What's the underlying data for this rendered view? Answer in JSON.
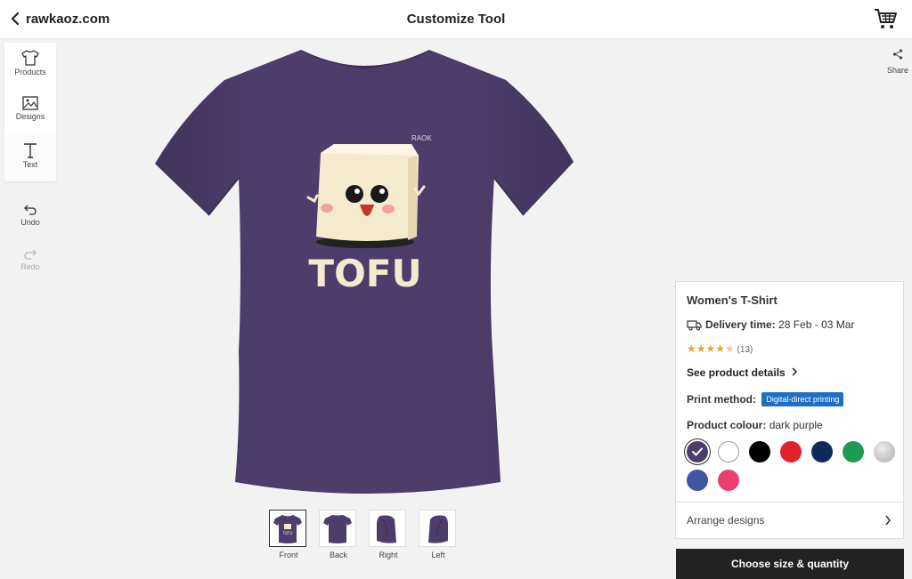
{
  "header": {
    "site_name": "rawkaoz.com",
    "title": "Customize Tool"
  },
  "toolbox": {
    "items": [
      {
        "label": "Products",
        "icon": "tshirt-icon"
      },
      {
        "label": "Designs",
        "icon": "image-icon"
      },
      {
        "label": "Text",
        "icon": "text-icon"
      }
    ],
    "undo_label": "Undo",
    "redo_label": "Redo"
  },
  "share_label": "Share",
  "canvas": {
    "shirt_colour": "#4d3d6b",
    "design_text": "TOFU",
    "design_signature": "RAOK"
  },
  "views": [
    {
      "label": "Front",
      "active": true
    },
    {
      "label": "Back",
      "active": false
    },
    {
      "label": "Right",
      "active": false
    },
    {
      "label": "Left",
      "active": false
    }
  ],
  "product": {
    "name": "Women's T-Shirt",
    "delivery_label": "Delivery time:",
    "delivery_value": "28 Feb - 03 Mar",
    "rating_stars": 4.5,
    "rating_count": "(13)",
    "details_link": "See product details",
    "print_label": "Print method:",
    "print_value": "Digital-direct printing",
    "colour_label": "Product colour:",
    "colour_value": "dark purple",
    "colours": [
      "#4d3d6b",
      "#ffffff",
      "#000000",
      "#e2232c",
      "#0f2a5a",
      "#1e9b52",
      "#c8c8c8",
      "#3f56a0",
      "#e8416f"
    ],
    "selected_colour": "#4d3d6b",
    "arrange_label": "Arrange designs"
  },
  "cta_label": "Choose size & quantity"
}
